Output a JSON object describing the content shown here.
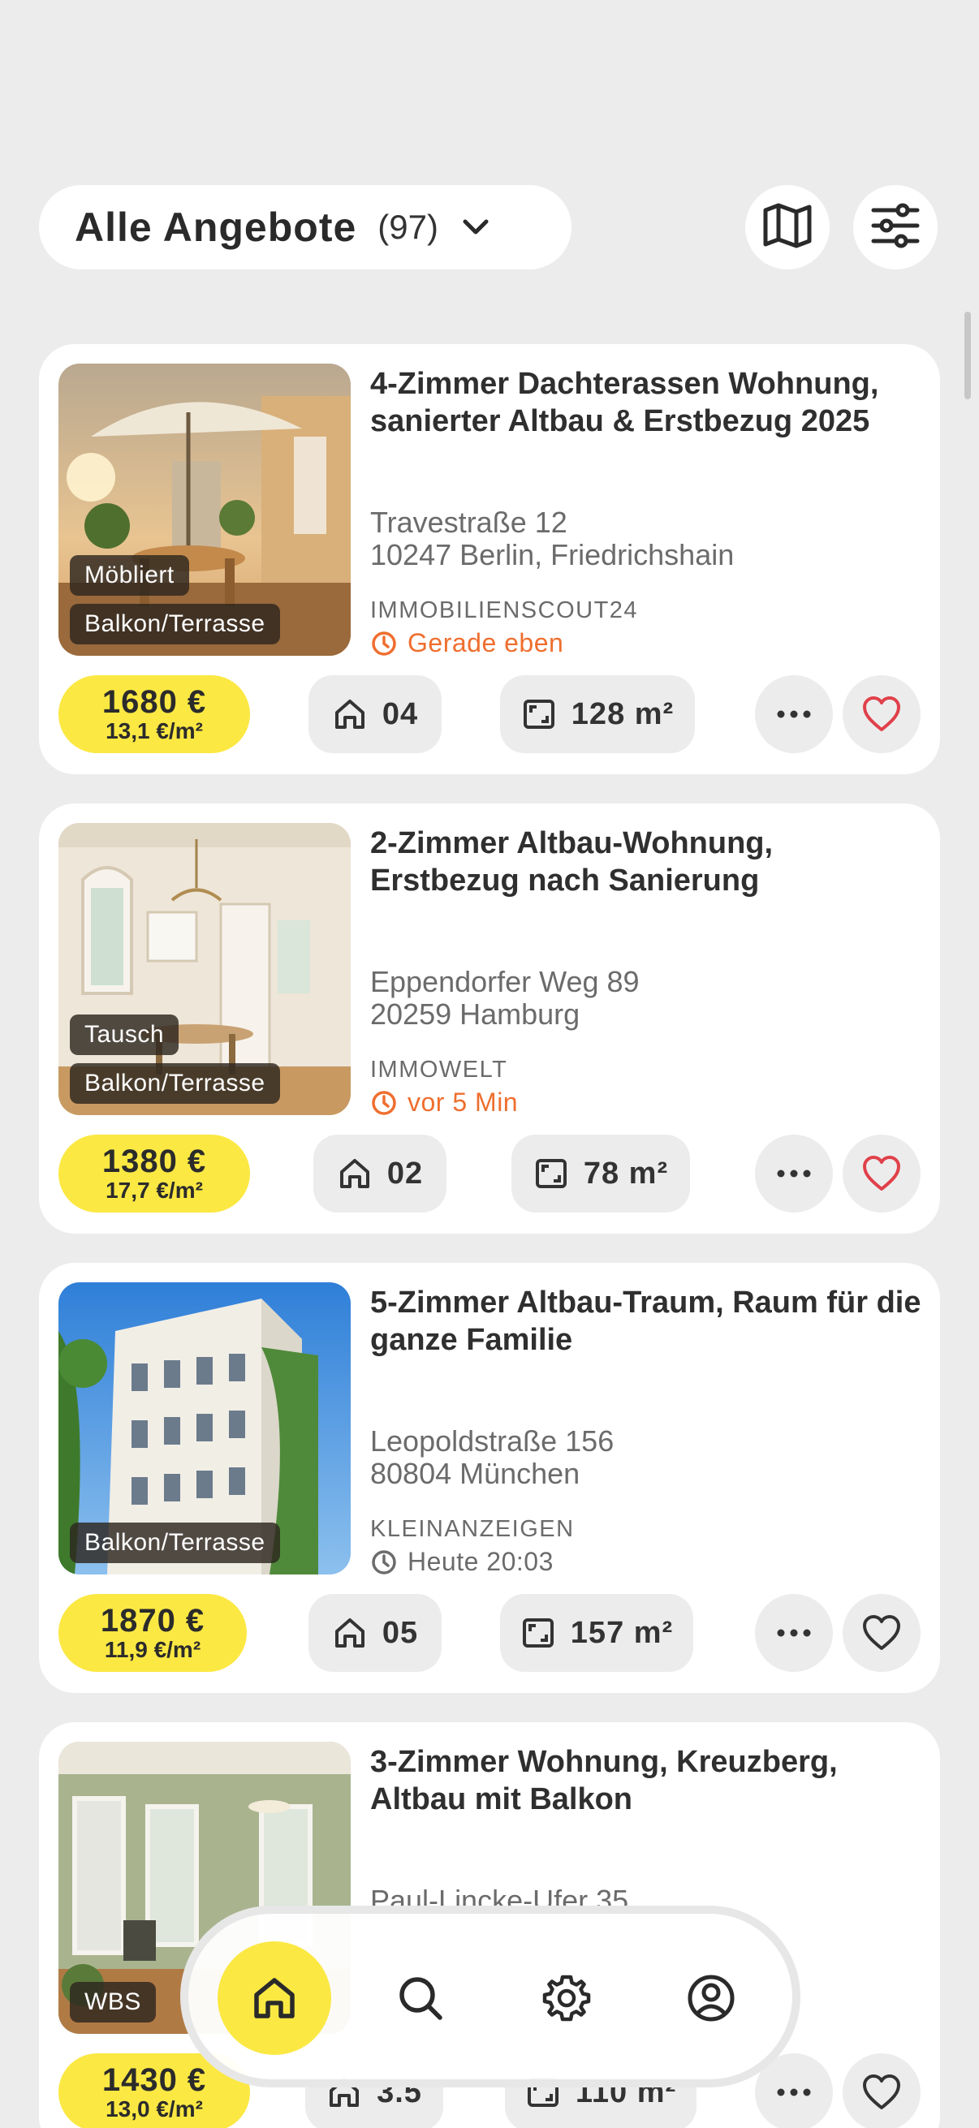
{
  "header": {
    "title": "Alle Angebote",
    "count": "(97)",
    "icons": [
      "chevron-down-icon",
      "map-icon",
      "filter-sliders-icon"
    ]
  },
  "colors": {
    "accent": "#fbe843",
    "time_recent": "#ef6e2e",
    "favorite": "#e0404a",
    "background": "#ececec"
  },
  "listings": [
    {
      "title": "4-Zimmer Dachterassen Wohnung, sanierter Altbau & Erstbezug 2025",
      "street": "Travestraße 12",
      "city": "10247 Berlin, Friedrichshain",
      "source": "IMMOBILIENSCOUT24",
      "time": "Gerade eben",
      "time_highlight": true,
      "tags": [
        "Möbliert",
        "Balkon/Terrasse"
      ],
      "price": "1680 €",
      "price_sqm": "13,1 €/m²",
      "rooms": "04",
      "area": "128 m²",
      "favorited": true
    },
    {
      "title": "2-Zimmer Altbau-Wohnung, Erstbezug nach Sanierung",
      "street": "Eppendorfer Weg 89",
      "city": "20259 Hamburg",
      "source": "IMMOWELT",
      "time": "vor 5 Min",
      "time_highlight": true,
      "tags": [
        "Tausch",
        "Balkon/Terrasse"
      ],
      "price": "1380 €",
      "price_sqm": "17,7 €/m²",
      "rooms": "02",
      "area": "78 m²",
      "favorited": true
    },
    {
      "title": "5-Zimmer Altbau-Traum, Raum für die ganze Familie",
      "street": "Leopoldstraße 156",
      "city": "80804 München",
      "source": "KLEINANZEIGEN",
      "time": "Heute 20:03",
      "time_highlight": false,
      "tags": [
        "Balkon/Terrasse"
      ],
      "price": "1870 €",
      "price_sqm": "11,9 €/m²",
      "rooms": "05",
      "area": "157 m²",
      "favorited": false
    },
    {
      "title": "3-Zimmer Wohnung, Kreuzberg, Altbau mit Balkon",
      "street": "Paul-Lincke-Ufer 35",
      "tags": [
        "WBS"
      ],
      "price": "1430 €",
      "price_sqm": "13,0 €/m²",
      "rooms": "3.5",
      "area": "110 m²",
      "favorited": false
    }
  ],
  "nav": {
    "items": [
      "home-icon",
      "search-icon",
      "gear-icon",
      "profile-icon"
    ],
    "active": "home-icon"
  }
}
